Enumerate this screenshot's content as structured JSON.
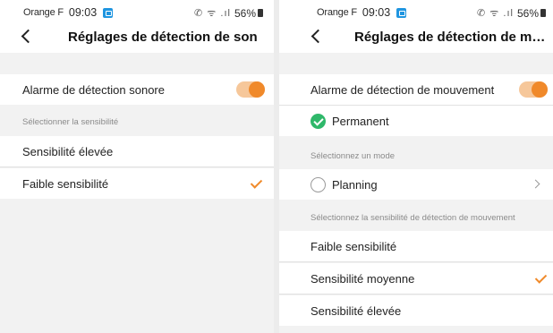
{
  "sound": {
    "status": {
      "carrier": "Orange F",
      "time": "09:03",
      "battery": "56%"
    },
    "title": "Réglages de détection de son",
    "alarm_label": "Alarme de détection sonore",
    "alarm_enabled": true,
    "sensitivity_section": "Sélectionner la sensibilité",
    "options": [
      {
        "label": "Sensibilité élevée",
        "selected": false
      },
      {
        "label": "Faible sensibilité",
        "selected": true
      }
    ]
  },
  "motion": {
    "status": {
      "carrier": "Orange F",
      "time": "09:03",
      "battery": "56%"
    },
    "title": "Réglages de détection de mouve...",
    "alarm_label": "Alarme de détection de mouvement",
    "alarm_enabled": true,
    "mode_permanent": "Permanent",
    "mode_section": "Sélectionnez un mode",
    "mode_planning": "Planning",
    "sensitivity_section": "Sélectionnez la sensibilité de détection de mouvement",
    "options": [
      {
        "label": "Faible sensibilité",
        "selected": false
      },
      {
        "label": "Sensibilité moyenne",
        "selected": true
      },
      {
        "label": "Sensibilité élevée",
        "selected": false
      }
    ]
  },
  "colors": {
    "accent": "#f0892a",
    "success": "#2fb86a"
  }
}
